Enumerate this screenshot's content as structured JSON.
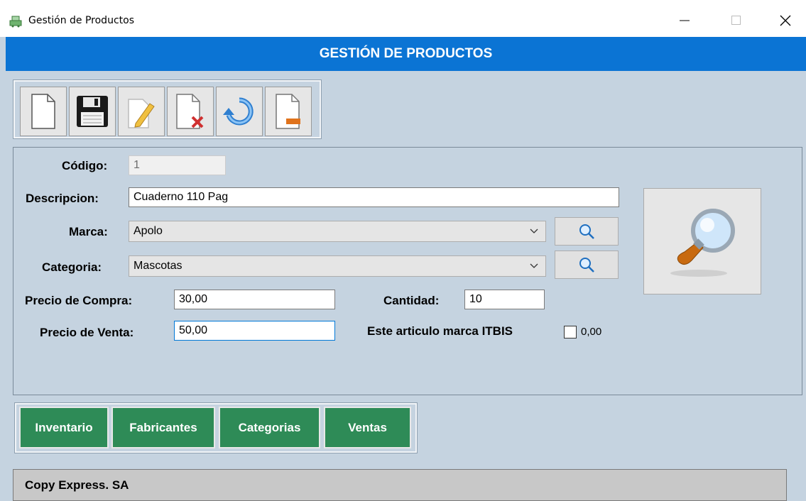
{
  "window": {
    "title": "Gestión de Productos",
    "icons": [
      "app-icon",
      "minimize-icon",
      "maximize-icon",
      "close-icon"
    ]
  },
  "header": {
    "title": "GESTIÓN DE PRODUCTOS"
  },
  "toolbar": {
    "buttons": [
      "new-document-icon",
      "save-icon",
      "edit-icon",
      "delete-icon",
      "undo-icon",
      "remove-icon"
    ]
  },
  "form": {
    "codigo": {
      "label": "Código:",
      "value": "1"
    },
    "descripcion": {
      "label": "Descripcion:",
      "value": "Cuaderno 110 Pag"
    },
    "marca": {
      "label": "Marca:",
      "value": "Apolo"
    },
    "categoria": {
      "label": "Categoria:",
      "value": "Mascotas"
    },
    "precio_compra": {
      "label": "Precio de Compra:",
      "value": "30,00"
    },
    "precio_venta": {
      "label": "Precio de Venta:",
      "value": "50,00"
    },
    "cantidad": {
      "label": "Cantidad:",
      "value": "10"
    },
    "itbis": {
      "label": "Este articulo marca ITBIS",
      "checked": false,
      "value": "0,00"
    }
  },
  "nav": {
    "inventario": "Inventario",
    "fabricantes": "Fabricantes",
    "categorias": "Categorias",
    "ventas": "Ventas"
  },
  "footer": {
    "company": "Copy Express. SA"
  },
  "colors": {
    "header": "#0b74d4",
    "nav_button": "#2e8b57",
    "background": "#c5d3e0"
  }
}
